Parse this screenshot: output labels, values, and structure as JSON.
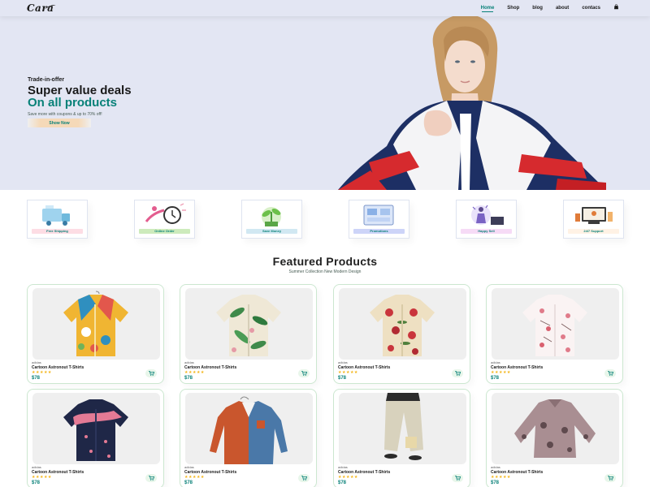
{
  "header": {
    "logo": "Cara",
    "nav": [
      {
        "label": "Home",
        "active": true
      },
      {
        "label": "Shop",
        "active": false
      },
      {
        "label": "blog",
        "active": false
      },
      {
        "label": "about",
        "active": false
      },
      {
        "label": "contacs",
        "active": false
      }
    ],
    "bag_icon": "shopping-bag-icon"
  },
  "hero": {
    "eyebrow": "Trade-in-offer",
    "headline_1": "Super value deals",
    "headline_2": "On all products",
    "subtext": "Save more with coupons & up to 70% off!",
    "button_label": "Show Now"
  },
  "features": [
    {
      "label": "Free Shipping",
      "tag_color": "#fddde4",
      "icon": "truck-shipping-icon"
    },
    {
      "label": "Online Order",
      "tag_color": "#cdebbc",
      "icon": "online-order-icon"
    },
    {
      "label": "Save Money",
      "tag_color": "#d1e8f2",
      "icon": "money-plant-icon"
    },
    {
      "label": "Promotions",
      "tag_color": "#cdd4f8",
      "icon": "promotions-icon"
    },
    {
      "label": "Happy Sell",
      "tag_color": "#f6dbf6",
      "icon": "happy-sell-icon"
    },
    {
      "label": "24/7 Support",
      "tag_color": "#fff2e5",
      "icon": "support-icon"
    }
  ],
  "featured": {
    "title": "Featured Products",
    "subtitle": "Summer Collection New Modern Design"
  },
  "products": [
    {
      "brand": "adidas",
      "name": "Cartoon Astronout T-Shirts",
      "stars": "★★★★★",
      "rating": 5,
      "price": "$78",
      "image": "colorful-print-shirt"
    },
    {
      "brand": "adidas",
      "name": "Cartoon Astronout T-Shirts",
      "stars": "★★★★★",
      "rating": 5,
      "price": "$78",
      "image": "palm-leaf-shirt"
    },
    {
      "brand": "adidas",
      "name": "Cartoon Astronout T-Shirts",
      "stars": "★★★★★",
      "rating": 5,
      "price": "$78",
      "image": "floral-cream-shirt"
    },
    {
      "brand": "adidas",
      "name": "Cartoon Astronout T-Shirts",
      "stars": "★★★★★",
      "rating": 5,
      "price": "$78",
      "image": "pink-blossom-shirt"
    },
    {
      "brand": "adidas",
      "name": "Cartoon Astronout T-Shirts",
      "stars": "★★★★★",
      "rating": 5,
      "price": "$78",
      "image": "navy-flamingo-shirt"
    },
    {
      "brand": "adidas",
      "name": "Cartoon Astronout T-Shirts",
      "stars": "★★★★★",
      "rating": 5,
      "price": "$78",
      "image": "orange-denim-shirt"
    },
    {
      "brand": "adidas",
      "name": "Cartoon Astronout T-Shirts",
      "stars": "★★★★★",
      "rating": 5,
      "price": "$78",
      "image": "beige-trousers"
    },
    {
      "brand": "adidas",
      "name": "Cartoon Astronout T-Shirts",
      "stars": "★★★★★",
      "rating": 5,
      "price": "$78",
      "image": "mauve-print-top"
    }
  ],
  "colors": {
    "accent": "#088178",
    "hero_bg": "#e3e6f3",
    "star": "#f3b519"
  }
}
